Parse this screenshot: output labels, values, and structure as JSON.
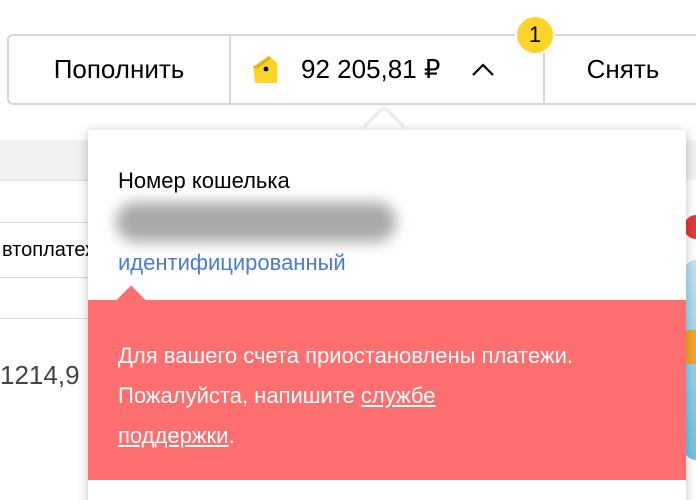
{
  "toolbar": {
    "topup_label": "Пополнить",
    "balance": "92 205,81 ₽",
    "withdraw_label": "Снять",
    "notification_count": "1",
    "wallet_icon": "yandex-money-wallet-icon",
    "chevron_icon": "chevron-up-icon",
    "colors": {
      "wallet_icon": "#fed42b",
      "badge": "#fed42b"
    }
  },
  "popup": {
    "wallet_label": "Номер кошелька",
    "wallet_status": "идентифицированный",
    "alert": {
      "text_before": "Для вашего счета приостановлены платежи. Пожалуйста, напишите ",
      "support_link_part1": "службе",
      "support_link_part2": "поддержки",
      "text_after": ".",
      "color": "#ff6f6f"
    }
  },
  "background": {
    "autopay_label": "втоплатеж",
    "amount_fragment": "1214,9"
  }
}
